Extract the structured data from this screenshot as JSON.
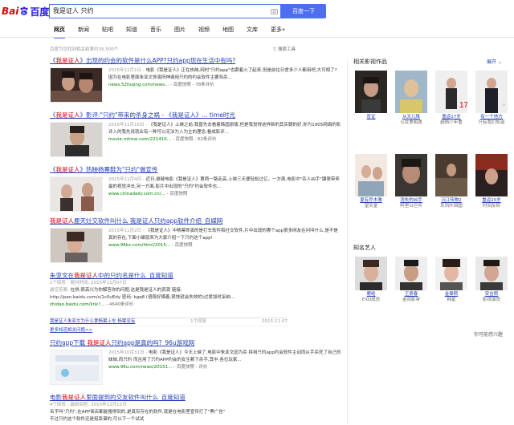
{
  "header": {
    "logo_left": "Bai",
    "logo_right": "百度",
    "query": "我是证人 只约",
    "search_button": "百度一下"
  },
  "tabs": [
    "网页",
    "新闻",
    "贴吧",
    "知道",
    "音乐",
    "图片",
    "视频",
    "地图",
    "文库",
    "更多»"
  ],
  "result_count": "百度为您找到相关结果约39,500个",
  "search_tools": "搜索工具",
  "results": [
    {
      "title_pre": "《",
      "title_em": "我是证人",
      "title_post": "》出现的约会的软件是什么APP?只约app现在生活中有吗?",
      "snippet_date": "2015年11月1日 - ",
      "snippet": "电影《我是证人》正在热映,网时\"只约app\"也跟着火了起来,但是前往日舍多少人都用吧,大可相了?因为在电影里面朱亚文饰演所神谢用只约的约会软件主要骂杀...",
      "url": "news.52fuqing.com/news...",
      "snapshot": "百度快照",
      "rating": "78条评价"
    },
    {
      "title_pre": "《",
      "title_em": "我是证人",
      "title_post": "》影评:\"只约\"带来的杀身之祸 - 《我是证人》... time时光",
      "snippet_date": "2015年11月16日 - ",
      "snippet": "《我是证人》上映之前,我曾先去看着韩国原版,但是我觉得这样新的其实朝的好,你为1905网络的影评入的我先说就业有一种可以无法为入为主的理念,看成影评...",
      "url": "movie.mtime.com/221410...",
      "snapshot": "百度快照",
      "rating": "62条评价"
    },
    {
      "title_pre": "《",
      "title_em": "我是证人",
      "title_post": "》热映杨幂鞋为\"只约\"做宣传",
      "snippet_date": "2015年11月4日 - ",
      "snippet": "近日,悬疑电影《我是证人》第两一路走高,上映三天便轻松过亿。一方面,电影中\"杀人凶手\"镰律带来最的视觉冲击,另一方面,影片中出现的\"只约\"约会软件也...",
      "url": "www.chinadaily.com.cn/...",
      "snapshot": "百度快照",
      "rating": ""
    },
    {
      "title_pre": "",
      "title_em": "我是证人",
      "title_post": "鹿天灶交软件叫什么 我是证人只约app软件介绍_自媒网",
      "snippet_date": "2015年11月2日 - ",
      "snippet": "《我是证人》中杨幂饰演的是打车软件和社交软件,片中出现的哪个app很多网友在问叫什么,是不是真的存在,下面小编就来为大家介绍一下只约这个app!",
      "url": "www.96kx.com/html/2015...",
      "snapshot": "百度快照",
      "rating": ""
    }
  ],
  "zhidao": {
    "title_pre": "朱亚文在",
    "title_em": "我是证人",
    "title_post": "中的只约名是什么_百度知道",
    "answers": "1个回答 - 提问时间: 2015年11月07日",
    "best_label": "最佳答案: ",
    "best": "在拼,很高兴为你解答你的问题,这是我是证人的资源 链接:",
    "link_line": "http://pan.baidu.com/s/1c0uEdy 密码: kgq8 (语段好摸着,很快就会失效的)过爱加时采纳...",
    "url": "zhidao.baidu.com/link?...",
    "rating": "4640条评价",
    "rows": [
      {
        "q": "我是证人朱亚文为什么拿杨幂上车 杨幂没有",
        "n": "1个回答",
        "d": "2015-11-07"
      }
    ],
    "more": "更多知道相关问题>>"
  },
  "result6": {
    "title_pre": "只约app下载 ",
    "title_em": "我是证人",
    "title_post": "只约app是真的吗?_96u游戏网",
    "snippet_date": "2015年10月31日 - ",
    "snippet": "电影《我是证人》今天上映了,电影中朱亚文因为杀",
    "snippet2": "拼用只约app约会软件主动而从手杀死了自己的妹妹,而只约 而且用了只约APP约会的女生赖下杀手,其中 各位玩家...",
    "url": "www.96u.com/news/20151...",
    "snapshot": "百度快照",
    "rating": "评价"
  },
  "result7": {
    "title_pre": "电影",
    "title_em": "我是证人",
    "title_post": "里面提到的交友软件叫什么_百度知道",
    "answers": "4个回答 - 最新回答: 2015年12月12日",
    "best": "名字叫\"只约\",在APP商店都能搜得到的,是真实存在的软件,就是在电影里宣传打了\"黑广告\"",
    "best2": "不过只约这个软件还是挺靠谱的,可以下一个试试"
  },
  "sidebar": {
    "related_title": "相关影视作品",
    "expand": "展开",
    "movies": [
      {
        "name": "盲证",
        "sub": ""
      },
      {
        "name": "从天儿降",
        "sub": "公女美相遇"
      },
      {
        "name": "重返17岁",
        "sub": "超萌少年重"
      },
      {
        "name": "有一个地方",
        "sub": "只有我们知道"
      },
      {
        "name": "夏有乔木雅",
        "sub": "望天堂"
      },
      {
        "name": "消失的凶手",
        "sub": "阿里以巨兵"
      },
      {
        "name": "沉江传物2",
        "sub": "灰风叶回国"
      },
      {
        "name": "重返20岁",
        "sub": "时间反转"
      }
    ],
    "celebs_title": "知名艺人",
    "celebs": [
      {
        "name": "鹿晗",
        "sub": "EXO成员"
      },
      {
        "name": "王景春",
        "sub": "金鸡影帝"
      },
      {
        "name": "金泰熙",
        "sub": "韩星"
      },
      {
        "name": "安吉熙",
        "sub": "影视演员"
      }
    ],
    "feedback": "你可能感兴趣"
  },
  "colors": {
    "accent": "#4e6ef2",
    "link": "#2440b3",
    "highlight": "#c00000",
    "url": "#008000"
  }
}
